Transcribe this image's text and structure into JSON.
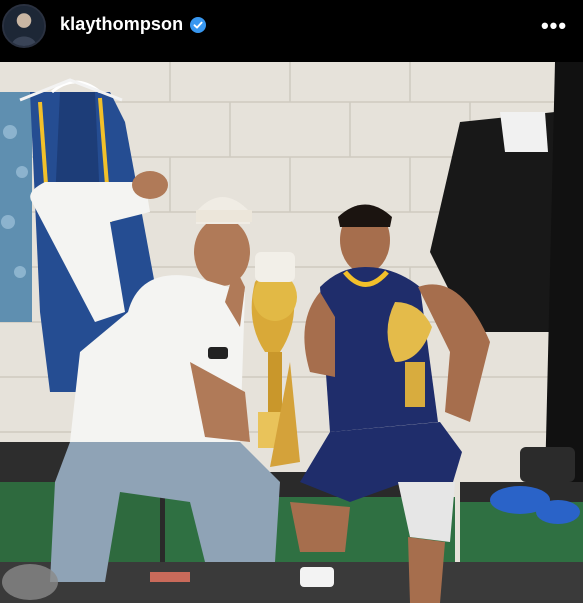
{
  "post": {
    "username": "klaythompson",
    "verified": true,
    "more_glyph": "•••"
  },
  "icons": {
    "avatar": "profile-avatar",
    "verified": "verified-badge-icon",
    "more": "more-options-icon"
  },
  "colors": {
    "header_bg": "#000000",
    "verified_blue": "#3897f0",
    "wall": "#e9e6df"
  }
}
